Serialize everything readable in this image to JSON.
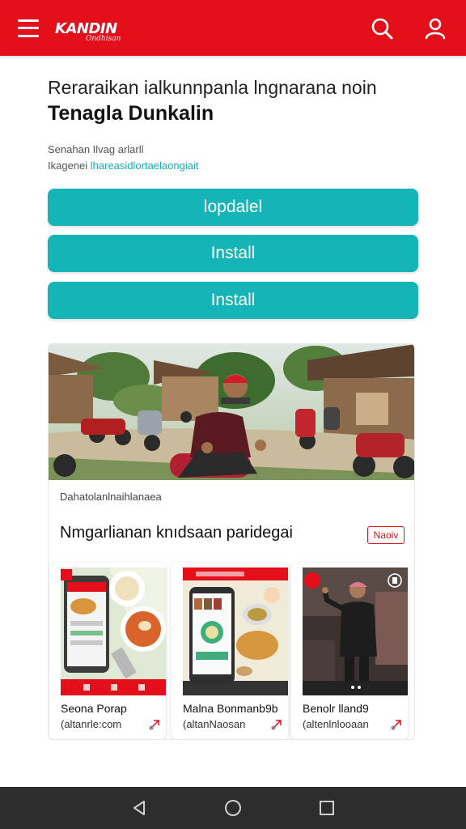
{
  "app": {
    "logo_main": "KANDIN",
    "logo_sub": "Ondhisan"
  },
  "icons": {
    "menu": "hamburger-menu-icon",
    "search": "search-icon",
    "profile": "user-icon",
    "share": "share-icon",
    "back": "back-icon",
    "home": "home-icon",
    "recents": "recents-icon"
  },
  "headline": {
    "subtitle": "Reraraikan ialkunnpanla lngnarana noin",
    "title": "Tenagla Dunkalin"
  },
  "meta": {
    "line1": "Senahan Ilvag  arlarll",
    "line2_prefix": "Ikagenei ",
    "line2_link": "lhareasidlortaelaongiait"
  },
  "buttons": [
    {
      "label": "lopdalel"
    },
    {
      "label": "Install"
    },
    {
      "label": "Install"
    }
  ],
  "card": {
    "caption": "Dahatolanlnaihlanaea",
    "section_title": "Nmgarlianan knıdsaan paridegai",
    "badge": "Naoiv",
    "thumbnails": [
      {
        "title": "Seona Porap",
        "source": "(altanrle:com"
      },
      {
        "title": "Malna Bonmanb9b",
        "source": "(altanNaosan"
      },
      {
        "title": "Benolr lland9",
        "source": "(altenlnlooaan"
      }
    ]
  },
  "colors": {
    "brand_red": "#e3101c",
    "teal": "#15b4b6",
    "navbar": "#2d2d2d"
  }
}
